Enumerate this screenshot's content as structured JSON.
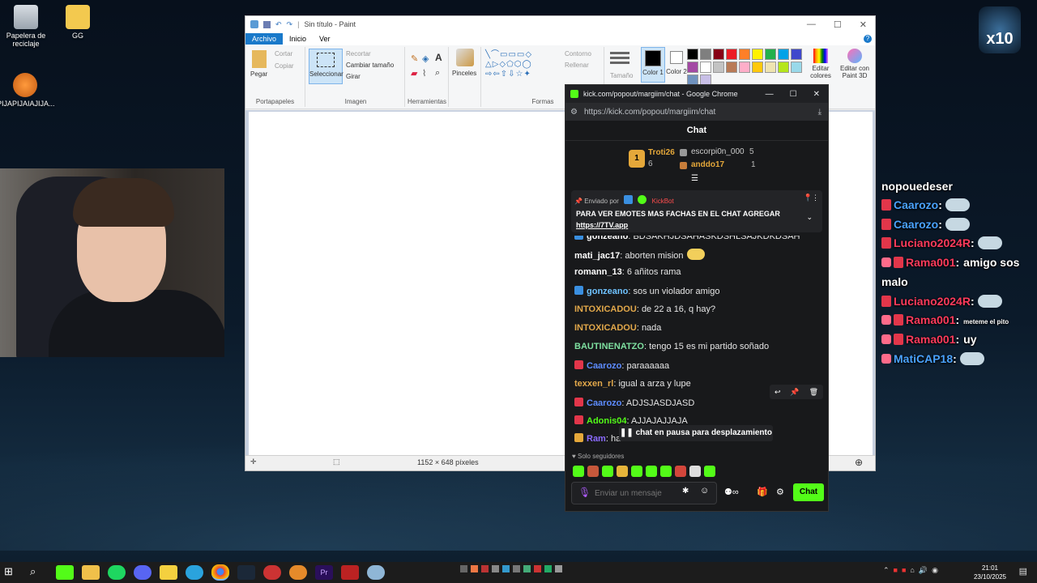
{
  "desktop": {
    "icons": [
      {
        "label": "Papelera de reciclaje",
        "icon": "recycle-bin-icon"
      },
      {
        "label": "GG",
        "icon": "folder-icon"
      },
      {
        "label": "PIJAPIJAIAJIJA...",
        "icon": "fl-studio-icon"
      }
    ]
  },
  "paint": {
    "title": "Sin título - Paint",
    "tabs": [
      "Archivo",
      "Inicio",
      "Ver"
    ],
    "clipboard": {
      "paste": "Pegar",
      "cut": "Cortar",
      "copy": "Copiar",
      "group": "Portapapeles"
    },
    "image": {
      "select": "Seleccionar",
      "crop": "Recortar",
      "resize": "Cambiar tamaño",
      "rotate": "Girar",
      "group": "Imagen"
    },
    "tools_group": "Herramientas",
    "brushes": "Pinceles",
    "shapes": {
      "outline": "Contorno",
      "fill": "Rellenar",
      "group": "Formas"
    },
    "size": "Tamaño",
    "color1": "Color 1",
    "color2": "Color 2",
    "edit_colors": "Editar colores",
    "paint3d": "Editar con Paint 3D",
    "palette": [
      "#000000",
      "#7f7f7f",
      "#880015",
      "#ed1c24",
      "#ff7f27",
      "#fff200",
      "#22b14c",
      "#00a2e8",
      "#3f48cc",
      "#a349a4",
      "#ffffff",
      "#c3c3c3",
      "#b97a57",
      "#ffaec9",
      "#ffc90e",
      "#efe4b0",
      "#b5e61d",
      "#99d9ea",
      "#7092be",
      "#c8bfe7"
    ],
    "status_size": "1152 × 648 píxeles"
  },
  "chat_window": {
    "title": "kick.com/popout/margiim/chat - Google Chrome",
    "url": "https://kick.com/popout/margiim/chat",
    "header": "Chat",
    "leaderboard": [
      {
        "name": "Troti26",
        "value": "6"
      },
      {
        "name": "escorpi0n_000",
        "value": "5"
      },
      {
        "name": "anddo17",
        "value": "1"
      }
    ],
    "pinned": {
      "sent_by": "Enviado por",
      "bot": "KickBot",
      "text": "PARA VER EMOTES MAS FACHAS EN EL CHAT AGREGAR",
      "link": "https://7TV.app"
    },
    "messages": [
      {
        "user": "gonzeano",
        "text": "BDSAKHJDSAHASKDSHLSAJKDKDSAH",
        "color": "#ffffff"
      },
      {
        "user": "mati_jac17",
        "text": "aborten mision",
        "color": "#ffffff"
      },
      {
        "user": "romann_13",
        "text": "6 añitos rama",
        "color": "#ffffff"
      },
      {
        "user": "gonzeano",
        "text": "sos un violador amigo",
        "color": "#6fc3ff"
      },
      {
        "user": "INTOXICADOU",
        "text": "de 22 a 16, q hay?",
        "color": "#e2a84a"
      },
      {
        "user": "INTOXICADOU",
        "text": "nada",
        "color": "#e2a84a"
      },
      {
        "user": "BAUTINENATZO",
        "text": "tengo 15 es mi partido soñado",
        "color": "#7ee0a0"
      },
      {
        "user": "Caarozo",
        "text": "paraaaaaa",
        "color": "#5d8cff"
      },
      {
        "user": "texxen_rl",
        "text": "igual a arza y lupe",
        "color": "#e2a84a"
      },
      {
        "user": "Caarozo",
        "text": "ADJSJASDJASD",
        "color": "#5d8cff"
      },
      {
        "user": "Adonis04",
        "text": "AJJAJAJJAJA",
        "color": "#53fc18"
      },
      {
        "user": "Ram",
        "text": "hat",
        "color": "#8b6bff"
      }
    ],
    "paused": "chat en pausa para desplazamiento",
    "followers_only": "Solo seguidores",
    "input_placeholder": "Enviar un mensaje",
    "send_label": "Chat"
  },
  "overlay_chat": [
    {
      "user": "nopouedeser",
      "text": "",
      "emote": false
    },
    {
      "user": "Caarozo",
      "text": "",
      "emote": true
    },
    {
      "user": "Caarozo",
      "text": "",
      "emote": true
    },
    {
      "user": "Luciano2024R",
      "text": "",
      "emote": true
    },
    {
      "user": "Rama001",
      "text": "amigo sos",
      "emote": false
    },
    {
      "user": "",
      "text": "malo",
      "emote": false
    },
    {
      "user": "Luciano2024R",
      "text": "",
      "emote": true
    },
    {
      "user": "Rama001",
      "text": "meteme el pito",
      "emote": false
    },
    {
      "user": "Rama001",
      "text": "uy",
      "emote": false
    },
    {
      "user": "MatiCAP18",
      "text": "",
      "emote": true
    }
  ],
  "overlay_logo": "x10",
  "taskbar": {
    "time": "21:01",
    "date": "23/10/2025"
  }
}
